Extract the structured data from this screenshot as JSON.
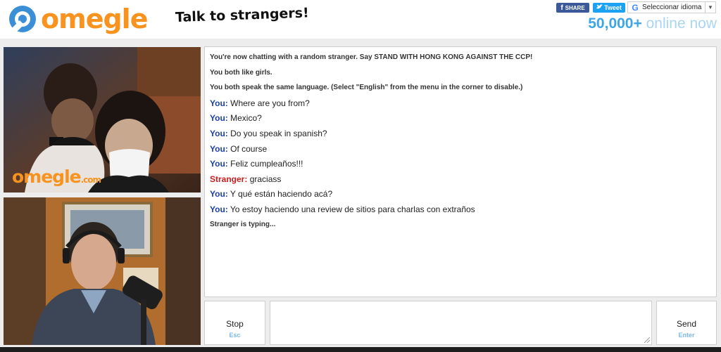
{
  "header": {
    "logo_text": "omegle",
    "tagline": "Talk to strangers!",
    "share": {
      "facebook_label": "SHARE",
      "facebook_icon": "facebook-icon",
      "twitter_label": "Tweet",
      "twitter_icon": "twitter-bird-icon"
    },
    "language": {
      "label": "Seleccionar idioma",
      "icon": "google-g-icon",
      "arrow": "▼"
    },
    "online": {
      "count": "50,000+",
      "suffix": "online now"
    }
  },
  "videos": {
    "stranger_watermark": "omegle",
    "stranger_watermark_suffix": ".com"
  },
  "chat": {
    "system": [
      "You're now chatting with a random stranger. Say STAND WITH HONG KONG AGAINST THE CCP!",
      "You both like girls.",
      "You both speak the same language. (Select \"English\" from the menu in the corner to disable.)"
    ],
    "messages": [
      {
        "sender": "You:",
        "text": "Where are you from?"
      },
      {
        "sender": "You:",
        "text": "Mexico?"
      },
      {
        "sender": "You:",
        "text": "Do you speak in spanish?"
      },
      {
        "sender": "You:",
        "text": "Of course"
      },
      {
        "sender": "You:",
        "text": "Feliz cumpleaños!!!"
      },
      {
        "sender": "Stranger:",
        "text": "graciass"
      },
      {
        "sender": "You:",
        "text": "Y qué están haciendo acá?"
      },
      {
        "sender": "You:",
        "text": "Yo estoy haciendo una review de sitios para charlas con extraños"
      }
    ],
    "typing": "Stranger is typing..."
  },
  "controls": {
    "stop_label": "Stop",
    "stop_key": "Esc",
    "send_label": "Send",
    "send_key": "Enter",
    "input_value": ""
  },
  "colors": {
    "brand_orange": "#f7931e",
    "you_blue": "#1c3fa8",
    "stranger_red": "#cc1d1d",
    "online_blue": "#3ea6e4"
  }
}
